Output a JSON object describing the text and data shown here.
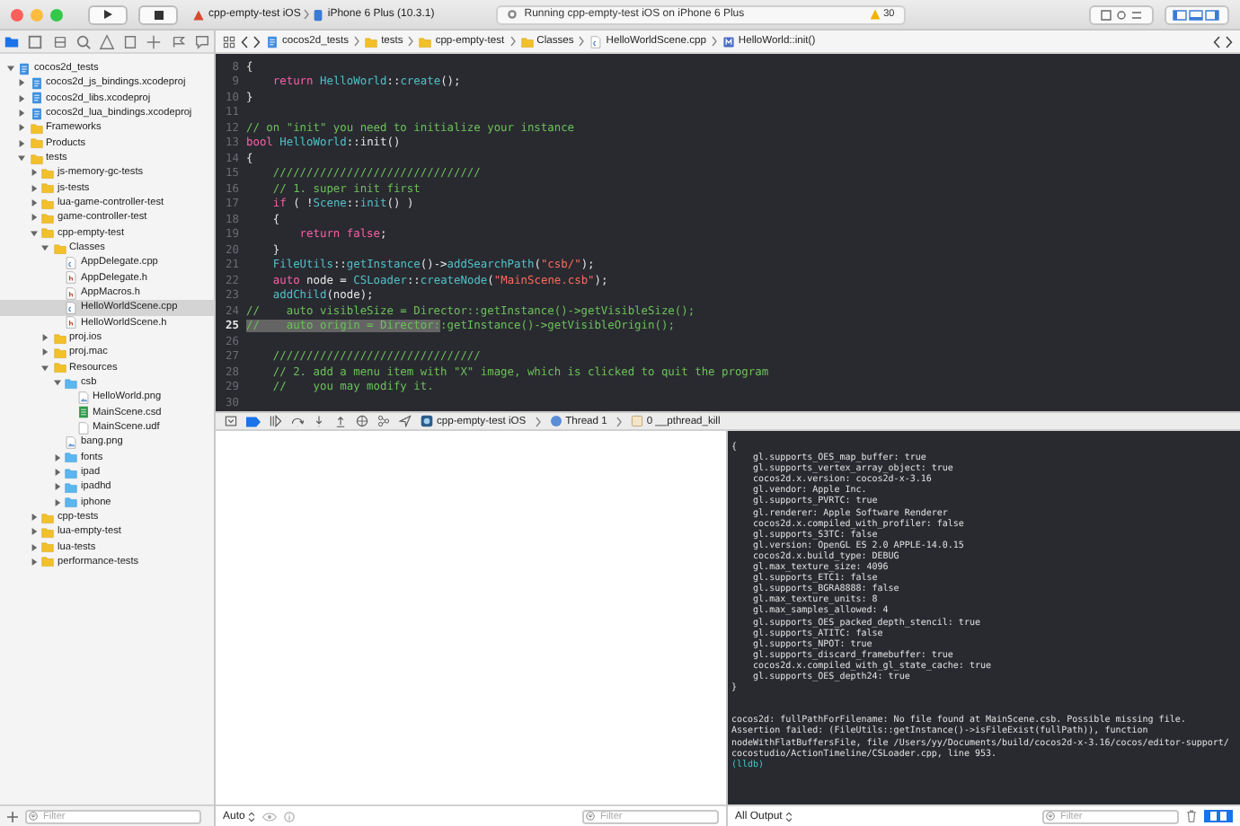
{
  "toolbar": {
    "scheme": {
      "target": "cpp-empty-test iOS",
      "device": "iPhone 6 Plus (10.3.1)"
    },
    "status": "Running cpp-empty-test iOS on iPhone 6 Plus",
    "warnings": "30"
  },
  "navigator": {
    "tabs": [
      {
        "selected": true
      },
      {
        "selected": false
      },
      {
        "selected": false
      },
      {
        "selected": false
      },
      {
        "selected": false
      },
      {
        "selected": false
      },
      {
        "selected": false
      },
      {
        "selected": false
      },
      {
        "selected": false
      }
    ],
    "filter": {
      "placeholder": "Filter"
    },
    "tree": [
      {
        "label": "cocos2d_tests",
        "kind": "project",
        "expanded": true,
        "selected": false,
        "children": [
          {
            "label": "cocos2d_js_bindings.xcodeproj",
            "kind": "project",
            "expanded": false,
            "selected": false
          },
          {
            "label": "cocos2d_libs.xcodeproj",
            "kind": "project",
            "expanded": false,
            "selected": false
          },
          {
            "label": "cocos2d_lua_bindings.xcodeproj",
            "kind": "project",
            "expanded": false,
            "selected": false
          },
          {
            "label": "Frameworks",
            "kind": "folder",
            "expanded": false,
            "selected": false
          },
          {
            "label": "Products",
            "kind": "folder",
            "expanded": false,
            "selected": false
          },
          {
            "label": "tests",
            "kind": "folder",
            "expanded": true,
            "selected": false,
            "children": [
              {
                "label": "js-memory-gc-tests",
                "kind": "folder",
                "expanded": false,
                "selected": false
              },
              {
                "label": "js-tests",
                "kind": "folder",
                "expanded": false,
                "selected": false
              },
              {
                "label": "lua-game-controller-test",
                "kind": "folder",
                "expanded": false,
                "selected": false
              },
              {
                "label": "game-controller-test",
                "kind": "folder",
                "expanded": false,
                "selected": false
              },
              {
                "label": "cpp-empty-test",
                "kind": "folder",
                "expanded": true,
                "selected": false,
                "children": [
                  {
                    "label": "Classes",
                    "kind": "folder",
                    "expanded": true,
                    "selected": false,
                    "children": [
                      {
                        "label": "AppDelegate.cpp",
                        "kind": "cpp",
                        "selected": false
                      },
                      {
                        "label": "AppDelegate.h",
                        "kind": "header",
                        "selected": false
                      },
                      {
                        "label": "AppMacros.h",
                        "kind": "header",
                        "selected": false
                      },
                      {
                        "label": "HelloWorldScene.cpp",
                        "kind": "cpp",
                        "selected": true
                      },
                      {
                        "label": "HelloWorldScene.h",
                        "kind": "header",
                        "selected": false
                      }
                    ]
                  },
                  {
                    "label": "proj.ios",
                    "kind": "folder",
                    "expanded": false,
                    "selected": false
                  },
                  {
                    "label": "proj.mac",
                    "kind": "folder",
                    "expanded": false,
                    "selected": false
                  },
                  {
                    "label": "Resources",
                    "kind": "folder",
                    "expanded": true,
                    "selected": false,
                    "children": [
                      {
                        "label": "csb",
                        "kind": "bluefolder",
                        "expanded": true,
                        "selected": false,
                        "children": [
                          {
                            "label": "HelloWorld.png",
                            "kind": "image",
                            "selected": false
                          },
                          {
                            "label": "MainScene.csd",
                            "kind": "csd",
                            "selected": false
                          },
                          {
                            "label": "MainScene.udf",
                            "kind": "file",
                            "selected": false
                          }
                        ]
                      },
                      {
                        "label": "bang.png",
                        "kind": "image",
                        "selected": false
                      },
                      {
                        "label": "fonts",
                        "kind": "bluefolder",
                        "expanded": false,
                        "selected": false
                      },
                      {
                        "label": "ipad",
                        "kind": "bluefolder",
                        "expanded": false,
                        "selected": false
                      },
                      {
                        "label": "ipadhd",
                        "kind": "bluefolder",
                        "expanded": false,
                        "selected": false
                      },
                      {
                        "label": "iphone",
                        "kind": "bluefolder",
                        "expanded": false,
                        "selected": false
                      }
                    ]
                  }
                ]
              },
              {
                "label": "cpp-tests",
                "kind": "folder",
                "expanded": false,
                "selected": false
              },
              {
                "label": "lua-empty-test",
                "kind": "folder",
                "expanded": false,
                "selected": false
              },
              {
                "label": "lua-tests",
                "kind": "folder",
                "expanded": false,
                "selected": false
              },
              {
                "label": "performance-tests",
                "kind": "folder",
                "expanded": false,
                "selected": false
              }
            ]
          }
        ]
      }
    ]
  },
  "jump_bar": [
    {
      "label": "cocos2d_tests",
      "kind": "project"
    },
    {
      "label": "tests",
      "kind": "folder"
    },
    {
      "label": "cpp-empty-test",
      "kind": "folder"
    },
    {
      "label": "Classes",
      "kind": "folder"
    },
    {
      "label": "HelloWorldScene.cpp",
      "kind": "cpp"
    },
    {
      "label": "HelloWorld::init()",
      "kind": "method"
    }
  ],
  "editor": {
    "lines": [
      {
        "number": "8",
        "current": false,
        "tokens": [
          {
            "t": "{",
            "kind": "plain"
          }
        ]
      },
      {
        "number": "9",
        "current": false,
        "tokens": [
          {
            "t": "    return",
            "kind": "keyword"
          },
          {
            "t": " HelloWorld",
            "kind": "type"
          },
          {
            "t": "::",
            "kind": "plain"
          },
          {
            "t": "create",
            "kind": "type"
          },
          {
            "t": "();",
            "kind": "plain"
          }
        ]
      },
      {
        "number": "10",
        "current": false,
        "tokens": [
          {
            "t": "}",
            "kind": "plain"
          }
        ]
      },
      {
        "number": "11",
        "current": false
      },
      {
        "number": "12",
        "current": false,
        "tokens": [
          {
            "t": "// on \"init\" you need to initialize your instance",
            "kind": "comment"
          }
        ]
      },
      {
        "number": "13",
        "current": false,
        "tokens": [
          {
            "t": "bool",
            "kind": "keyword"
          },
          {
            "t": " HelloWorld",
            "kind": "type"
          },
          {
            "t": "::init()",
            "kind": "plain"
          }
        ]
      },
      {
        "number": "14",
        "current": false,
        "tokens": [
          {
            "t": "{",
            "kind": "plain"
          }
        ]
      },
      {
        "number": "15",
        "current": false,
        "tokens": [
          {
            "t": "    ///////////////////////////////",
            "kind": "comment"
          }
        ]
      },
      {
        "number": "16",
        "current": false,
        "tokens": [
          {
            "t": "    // 1. super init first",
            "kind": "comment"
          }
        ]
      },
      {
        "number": "17",
        "current": false,
        "tokens": [
          {
            "t": "    if",
            "kind": "keyword"
          },
          {
            "t": " ( !",
            "kind": "plain"
          },
          {
            "t": "Scene",
            "kind": "type"
          },
          {
            "t": "::",
            "kind": "plain"
          },
          {
            "t": "init",
            "kind": "type"
          },
          {
            "t": "() )",
            "kind": "plain"
          }
        ]
      },
      {
        "number": "18",
        "current": false,
        "tokens": [
          {
            "t": "    {",
            "kind": "plain"
          }
        ]
      },
      {
        "number": "19",
        "current": false,
        "tokens": [
          {
            "t": "        return false",
            "kind": "keyword"
          },
          {
            "t": ";",
            "kind": "plain"
          }
        ]
      },
      {
        "number": "20",
        "current": false,
        "tokens": [
          {
            "t": "    }",
            "kind": "plain"
          }
        ]
      },
      {
        "number": "21",
        "current": false,
        "tokens": [
          {
            "t": "    FileUtils",
            "kind": "type"
          },
          {
            "t": "::",
            "kind": "plain"
          },
          {
            "t": "getInstance",
            "kind": "type"
          },
          {
            "t": "()->",
            "kind": "plain"
          },
          {
            "t": "addSearchPath",
            "kind": "type"
          },
          {
            "t": "(",
            "kind": "plain"
          },
          {
            "t": "\"csb/\"",
            "kind": "string"
          },
          {
            "t": ");",
            "kind": "plain"
          }
        ]
      },
      {
        "number": "22",
        "current": false,
        "tokens": [
          {
            "t": "    auto",
            "kind": "keyword"
          },
          {
            "t": " node = ",
            "kind": "plain"
          },
          {
            "t": "CSLoader",
            "kind": "type"
          },
          {
            "t": "::",
            "kind": "plain"
          },
          {
            "t": "createNode",
            "kind": "type"
          },
          {
            "t": "(",
            "kind": "plain"
          },
          {
            "t": "\"MainScene.csb\"",
            "kind": "string"
          },
          {
            "t": ");",
            "kind": "plain"
          }
        ]
      },
      {
        "number": "23",
        "current": false,
        "tokens": [
          {
            "t": "    addChild",
            "kind": "type"
          },
          {
            "t": "(node);",
            "kind": "plain"
          }
        ]
      },
      {
        "number": "24",
        "current": false,
        "tokens": [
          {
            "t": "//    auto visibleSize = Director::getInstance()->getVisibleSize();",
            "kind": "comment"
          }
        ]
      },
      {
        "number": "25",
        "current": true,
        "tokens": [
          {
            "t": "//    auto origin = Director:",
            "kind": "selection"
          },
          {
            "t": ":getInstance()->getVisibleOrigin();",
            "kind": "comment"
          }
        ]
      },
      {
        "number": "26",
        "current": false
      },
      {
        "number": "27",
        "current": false,
        "tokens": [
          {
            "t": "    ///////////////////////////////",
            "kind": "comment"
          }
        ]
      },
      {
        "number": "28",
        "current": false,
        "tokens": [
          {
            "t": "    // 2. add a menu item with \"X\" image, which is clicked to quit the program",
            "kind": "comment"
          }
        ]
      },
      {
        "number": "29",
        "current": false,
        "tokens": [
          {
            "t": "    //    you may modify it.",
            "kind": "comment"
          }
        ]
      },
      {
        "number": "30",
        "current": false
      }
    ]
  },
  "debug_bar": [
    {
      "label": "cpp-empty-test iOS",
      "kind": "app"
    },
    {
      "label": "Thread 1",
      "kind": "thread"
    },
    {
      "label": "0 __pthread_kill",
      "kind": "frame"
    }
  ],
  "variables": {
    "scope": "Auto",
    "filter": {
      "placeholder": "Filter"
    }
  },
  "console": {
    "output": [
      "{",
      "    gl.supports_OES_map_buffer: true",
      "    gl.supports_vertex_array_object: true",
      "    cocos2d.x.version: cocos2d-x-3.16",
      "    gl.vendor: Apple Inc.",
      "    gl.supports_PVRTC: true",
      "    gl.renderer: Apple Software Renderer",
      "    cocos2d.x.compiled_with_profiler: false",
      "    gl.supports_S3TC: false",
      "    gl.version: OpenGL ES 2.0 APPLE-14.0.15",
      "    cocos2d.x.build_type: DEBUG",
      "    gl.max_texture_size: 4096",
      "    gl.supports_ETC1: false",
      "    gl.supports_BGRA8888: false",
      "    gl.max_texture_units: 8",
      "    gl.max_samples_allowed: 4",
      "    gl.supports_OES_packed_depth_stencil: true",
      "    gl.supports_ATITC: false",
      "    gl.supports_NPOT: true",
      "    gl.supports_discard_framebuffer: true",
      "    cocos2d.x.compiled_with_gl_state_cache: true",
      "    gl.supports_OES_depth24: true",
      "}"
    ],
    "messages": [
      "cocos2d: fullPathForFilename: No file found at MainScene.csb. Possible missing file.",
      "Assertion failed: (FileUtils::getInstance()->isFileExist(fullPath)), function",
      "nodeWithFlatBuffersFile, file /Users/yy/Documents/build/cocos2d-x-3.16/cocos/editor-support/",
      "cocostudio/ActionTimeline/CSLoader.cpp, line 953."
    ],
    "prompt": "(lldb)",
    "scope": "All Output",
    "filter": {
      "placeholder": "Filter"
    }
  }
}
